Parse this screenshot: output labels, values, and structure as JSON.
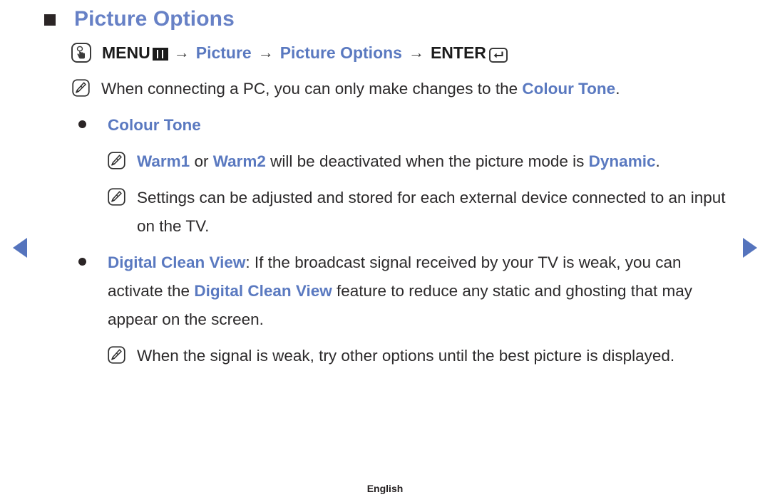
{
  "page": {
    "title": "Picture Options",
    "footer_language": "English"
  },
  "nav": {
    "prev_label": "Previous page",
    "next_label": "Next page"
  },
  "menu_path": {
    "hand_icon": "hand-press-icon",
    "menu_label": "MENU",
    "menu_icon": "menu-grid-icon",
    "arrow": "→",
    "step_picture": "Picture",
    "step_picture_options": "Picture Options",
    "enter_label": "ENTER",
    "enter_icon": "enter-key-icon"
  },
  "content": [
    {
      "marker": "note-pencil-icon",
      "indent": 0,
      "parts": [
        {
          "text": "When connecting a PC, you can only make changes to the ",
          "style": "normal"
        },
        {
          "text": "Colour Tone",
          "style": "blue"
        },
        {
          "text": ".",
          "style": "normal"
        }
      ]
    },
    {
      "marker": "bullet-dot",
      "indent": 1,
      "parts": [
        {
          "text": "Colour Tone",
          "style": "blue"
        }
      ]
    },
    {
      "marker": "note-pencil-icon",
      "indent": 2,
      "parts": [
        {
          "text": "Warm1",
          "style": "blue"
        },
        {
          "text": " or ",
          "style": "normal"
        },
        {
          "text": "Warm2",
          "style": "blue"
        },
        {
          "text": " will be deactivated when the picture mode is ",
          "style": "normal"
        },
        {
          "text": "Dynamic",
          "style": "blue"
        },
        {
          "text": ".",
          "style": "normal"
        }
      ]
    },
    {
      "marker": "note-pencil-icon",
      "indent": 2,
      "parts": [
        {
          "text": "Settings can be adjusted and stored for each external device connected to an input on the TV.",
          "style": "normal"
        }
      ]
    },
    {
      "marker": "bullet-dot",
      "indent": 1,
      "parts": [
        {
          "text": "Digital Clean View",
          "style": "blue"
        },
        {
          "text": ": If the broadcast signal received by your TV is weak, you can activate the ",
          "style": "normal"
        },
        {
          "text": "Digital Clean View",
          "style": "blue"
        },
        {
          "text": " feature to reduce any static and ghosting that may appear on the screen.",
          "style": "normal"
        }
      ]
    },
    {
      "marker": "note-pencil-icon",
      "indent": 2,
      "parts": [
        {
          "text": "When the signal is weak, try other options until the best picture is displayed.",
          "style": "normal"
        }
      ]
    }
  ],
  "colors": {
    "accent_blue": "#5a79c0",
    "title_blue": "#6781c6",
    "arrow_blue": "#5574bd",
    "text_dark": "#2c2a2b"
  }
}
